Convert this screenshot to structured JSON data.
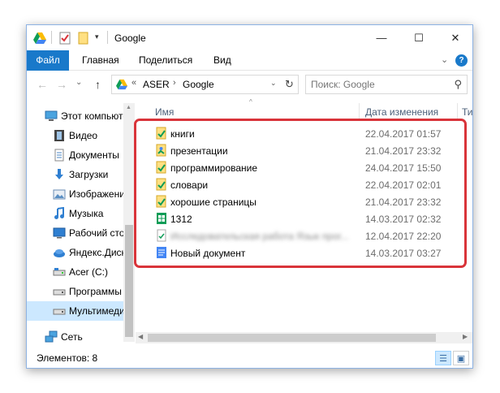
{
  "window": {
    "title": "Google",
    "controls": {
      "minimize": "—",
      "maximize": "☐",
      "close": "✕"
    }
  },
  "ribbon": {
    "tabs": [
      {
        "label": "Файл"
      },
      {
        "label": "Главная"
      },
      {
        "label": "Поделиться"
      },
      {
        "label": "Вид"
      }
    ],
    "expand_glyph": "⌄",
    "help_glyph": "?"
  },
  "navigation": {
    "back_glyph": "←",
    "forward_glyph": "→",
    "recent_glyph": "⌄",
    "up_glyph": "↑",
    "address": {
      "overflow": "«",
      "segments": [
        "ASER",
        "Google"
      ],
      "separator": "›",
      "dropdown_glyph": "⌄",
      "refresh_glyph": "↻"
    },
    "search": {
      "placeholder": "Поиск: Google",
      "icon_glyph": "⚲"
    }
  },
  "sidebar": {
    "items": [
      {
        "label": "Этот компьютер",
        "icon": "computer-icon"
      },
      {
        "label": "Видео",
        "icon": "video-icon"
      },
      {
        "label": "Документы",
        "icon": "documents-icon"
      },
      {
        "label": "Загрузки",
        "icon": "downloads-icon"
      },
      {
        "label": "Изображения",
        "icon": "pictures-icon"
      },
      {
        "label": "Музыка",
        "icon": "music-icon"
      },
      {
        "label": "Рабочий стол",
        "icon": "desktop-icon"
      },
      {
        "label": "Яндекс.Диск",
        "icon": "yandex-disk-icon"
      },
      {
        "label": "Acer (C:)",
        "icon": "drive-icon"
      },
      {
        "label": "Программы",
        "icon": "drive-icon"
      },
      {
        "label": "Мультимедиа",
        "icon": "drive-icon",
        "selected": true
      },
      {
        "label": "Сеть",
        "icon": "network-icon"
      }
    ]
  },
  "file_list": {
    "columns": {
      "name": "Имя",
      "date": "Дата изменения",
      "type": "Ти"
    },
    "rows": [
      {
        "name": "книги",
        "date": "22.04.2017 01:57",
        "icon": "drive-folder-icon"
      },
      {
        "name": "презентации",
        "date": "21.04.2017 23:32",
        "icon": "slides-icon"
      },
      {
        "name": "программирование",
        "date": "24.04.2017 15:50",
        "icon": "drive-folder-icon"
      },
      {
        "name": "словари",
        "date": "22.04.2017 02:01",
        "icon": "drive-folder-icon"
      },
      {
        "name": "хорошие страницы",
        "date": "21.04.2017 23:32",
        "icon": "drive-folder-icon"
      },
      {
        "name": "1312",
        "date": "14.03.2017 02:32",
        "icon": "sheets-icon"
      },
      {
        "name": "Исследовательская работа Язык прог...",
        "date": "12.04.2017 22:20",
        "icon": "file-icon",
        "blurred": true
      },
      {
        "name": "Новый документ",
        "date": "14.03.2017 03:27",
        "icon": "docs-icon"
      }
    ]
  },
  "status": {
    "items_count": "Элементов: 8"
  },
  "colors": {
    "accent": "#1979ca",
    "highlight": "#d9343a",
    "selected": "#cce8ff"
  }
}
